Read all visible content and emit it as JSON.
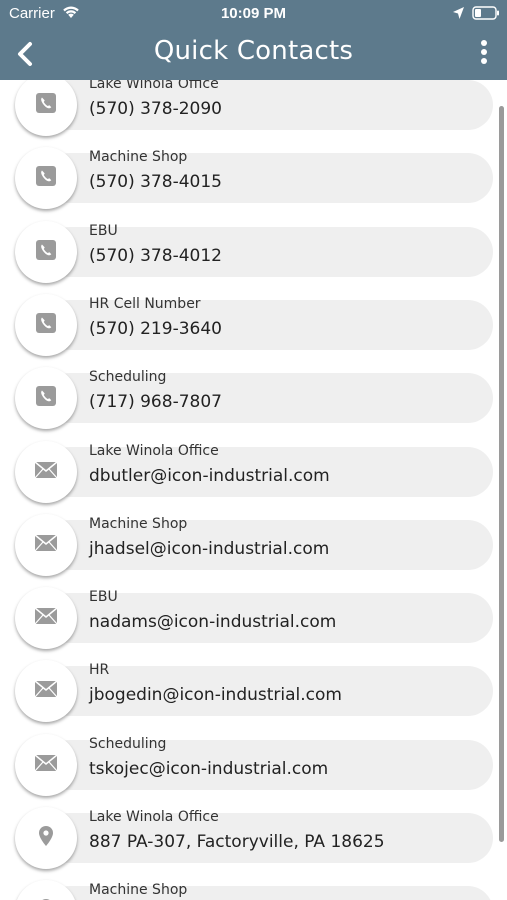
{
  "status_bar": {
    "carrier": "Carrier",
    "time": "10:09 PM",
    "icons": [
      "wifi-icon",
      "location-icon",
      "battery-icon"
    ]
  },
  "nav": {
    "title": "Quick Contacts",
    "back_icon": "chevron-left-icon",
    "more_icon": "more-vertical-icon"
  },
  "colors": {
    "nav_background": "#5d7a8c",
    "item_background": "#efefef",
    "icon_color": "#9b9b9b"
  },
  "contacts": [
    {
      "icon": "phone-icon",
      "label": "Lake Winola Office",
      "value": "(570) 378-2090"
    },
    {
      "icon": "phone-icon",
      "label": "Machine Shop",
      "value": "(570) 378-4015"
    },
    {
      "icon": "phone-icon",
      "label": "EBU",
      "value": "(570) 378-4012"
    },
    {
      "icon": "phone-icon",
      "label": "HR Cell Number",
      "value": "(570) 219-3640"
    },
    {
      "icon": "phone-icon",
      "label": "Scheduling",
      "value": "(717) 968-7807"
    },
    {
      "icon": "mail-icon",
      "label": "Lake Winola Office",
      "value": "dbutler@icon-industrial.com"
    },
    {
      "icon": "mail-icon",
      "label": "Machine Shop",
      "value": "jhadsel@icon-industrial.com"
    },
    {
      "icon": "mail-icon",
      "label": "EBU",
      "value": "nadams@icon-industrial.com"
    },
    {
      "icon": "mail-icon",
      "label": "HR",
      "value": "jbogedin@icon-industrial.com"
    },
    {
      "icon": "mail-icon",
      "label": "Scheduling",
      "value": "tskojec@icon-industrial.com"
    },
    {
      "icon": "location-pin-icon",
      "label": "Lake Winola Office",
      "value": "887 PA-307, Factoryville, PA 18625"
    },
    {
      "icon": "location-pin-icon",
      "label": "Machine Shop",
      "value": ""
    }
  ]
}
